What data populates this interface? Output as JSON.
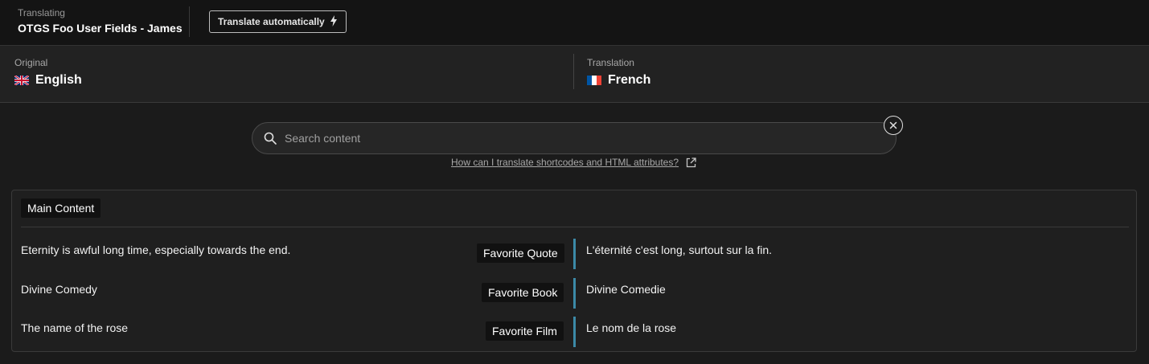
{
  "header": {
    "subtitle": "Translating",
    "title": "OTGS Foo User Fields - James",
    "auto_translate_label": "Translate automatically",
    "auto_translate_icon": "lightning-bolt-icon"
  },
  "languages": {
    "original": {
      "label": "Original",
      "name": "English",
      "flag": "uk-flag-icon"
    },
    "translation": {
      "label": "Translation",
      "name": "French",
      "flag": "france-flag-icon"
    }
  },
  "search": {
    "placeholder": "Search content",
    "icon": "search-icon",
    "clear_icon": "close-icon",
    "help_text": "How can I translate shortcodes and HTML attributes?",
    "help_icon": "external-link-icon"
  },
  "section": {
    "title": "Main Content",
    "accent_color": "#3c8aa8",
    "rows": [
      {
        "original": "Eternity is awful long time, especially towards the end.",
        "field": "Favorite Quote",
        "translation": "L'éternité c'est long, surtout sur la fin."
      },
      {
        "original": "Divine Comedy",
        "field": "Favorite Book",
        "translation": "Divine Comedie"
      },
      {
        "original": "The name of the rose",
        "field": "Favorite Film",
        "translation": "Le nom de la rose"
      }
    ]
  }
}
